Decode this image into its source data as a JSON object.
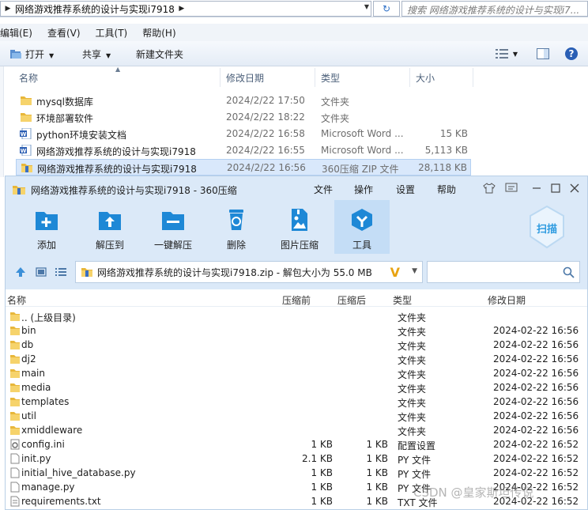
{
  "explorer": {
    "address_path": "网络游戏推荐系统的设计与实现i7918",
    "search_placeholder": "搜索 网络游戏推荐系统的设计与实现i7...",
    "menu": [
      "编辑(E)",
      "查看(V)",
      "工具(T)",
      "帮助(H)"
    ],
    "toolbar": {
      "open": "打开",
      "share": "共享",
      "new_folder": "新建文件夹"
    },
    "columns": {
      "name": "名称",
      "date": "修改日期",
      "type": "类型",
      "size": "大小"
    },
    "files": [
      {
        "name": "mysql数据库",
        "date": "2024/2/22 17:50",
        "type": "文件夹",
        "size": "",
        "icon": "folder-icon"
      },
      {
        "name": "环境部署软件",
        "date": "2024/2/22 18:22",
        "type": "文件夹",
        "size": "",
        "icon": "folder-icon"
      },
      {
        "name": "python环境安装文档",
        "date": "2024/2/22 16:58",
        "type": "Microsoft Word ...",
        "size": "15 KB",
        "icon": "word-doc-icon"
      },
      {
        "name": "网络游戏推荐系统的设计与实现i7918",
        "date": "2024/2/22 16:55",
        "type": "Microsoft Word ...",
        "size": "5,113 KB",
        "icon": "word-doc-icon"
      },
      {
        "name": "网络游戏推荐系统的设计与实现i7918",
        "date": "2024/2/22 16:56",
        "type": "360压缩 ZIP 文件",
        "size": "28,118 KB",
        "icon": "zip-archive-icon"
      }
    ]
  },
  "zip": {
    "title": "网络游戏推荐系统的设计与实现i7918 - 360压缩",
    "menu": {
      "file": "文件",
      "operate": "操作",
      "settings": "设置",
      "help": "帮助"
    },
    "tools": {
      "add": "添加",
      "extract_to": "解压到",
      "one_click": "一键解压",
      "delete": "删除",
      "image_compress": "图片压缩",
      "tools": "工具"
    },
    "scan_label": "扫描",
    "path_text": "网络游戏推荐系统的设计与实现i7918.zip - 解包大小为 55.0 MB",
    "columns": {
      "name": "名称",
      "compressed": "压缩前",
      "uncompressed": "压缩后",
      "type": "类型",
      "date": "修改日期"
    },
    "files": [
      {
        "name": ".. (上级目录)",
        "cs": "",
        "us": "",
        "type": "文件夹",
        "date": "",
        "icon": "folder-icon"
      },
      {
        "name": "bin",
        "cs": "",
        "us": "",
        "type": "文件夹",
        "date": "2024-02-22 16:56",
        "icon": "folder-icon"
      },
      {
        "name": "db",
        "cs": "",
        "us": "",
        "type": "文件夹",
        "date": "2024-02-22 16:56",
        "icon": "folder-icon"
      },
      {
        "name": "dj2",
        "cs": "",
        "us": "",
        "type": "文件夹",
        "date": "2024-02-22 16:56",
        "icon": "folder-icon"
      },
      {
        "name": "main",
        "cs": "",
        "us": "",
        "type": "文件夹",
        "date": "2024-02-22 16:56",
        "icon": "folder-icon"
      },
      {
        "name": "media",
        "cs": "",
        "us": "",
        "type": "文件夹",
        "date": "2024-02-22 16:56",
        "icon": "folder-icon"
      },
      {
        "name": "templates",
        "cs": "",
        "us": "",
        "type": "文件夹",
        "date": "2024-02-22 16:56",
        "icon": "folder-icon"
      },
      {
        "name": "util",
        "cs": "",
        "us": "",
        "type": "文件夹",
        "date": "2024-02-22 16:56",
        "icon": "folder-icon"
      },
      {
        "name": "xmiddleware",
        "cs": "",
        "us": "",
        "type": "文件夹",
        "date": "2024-02-22 16:56",
        "icon": "folder-icon"
      },
      {
        "name": "config.ini",
        "cs": "1 KB",
        "us": "1 KB",
        "type": "配置设置",
        "date": "2024-02-22 16:52",
        "icon": "settings-file-icon"
      },
      {
        "name": "init.py",
        "cs": "2.1 KB",
        "us": "1 KB",
        "type": "PY 文件",
        "date": "2024-02-22 16:52",
        "icon": "file-icon"
      },
      {
        "name": "initial_hive_database.py",
        "cs": "1 KB",
        "us": "1 KB",
        "type": "PY 文件",
        "date": "2024-02-22 16:52",
        "icon": "file-icon"
      },
      {
        "name": "manage.py",
        "cs": "1 KB",
        "us": "1 KB",
        "type": "PY 文件",
        "date": "2024-02-22 16:52",
        "icon": "file-icon"
      },
      {
        "name": "requirements.txt",
        "cs": "1 KB",
        "us": "1 KB",
        "type": "TXT 文件",
        "date": "2024-02-22 16:52",
        "icon": "text-file-icon"
      }
    ]
  },
  "watermark": "CSDN @皇家斯坦传说",
  "colors": {
    "accent": "#1e88d6",
    "header_bg": "#dbe9f8",
    "selected": "#d9e8fb",
    "folder": "#f0c040"
  }
}
